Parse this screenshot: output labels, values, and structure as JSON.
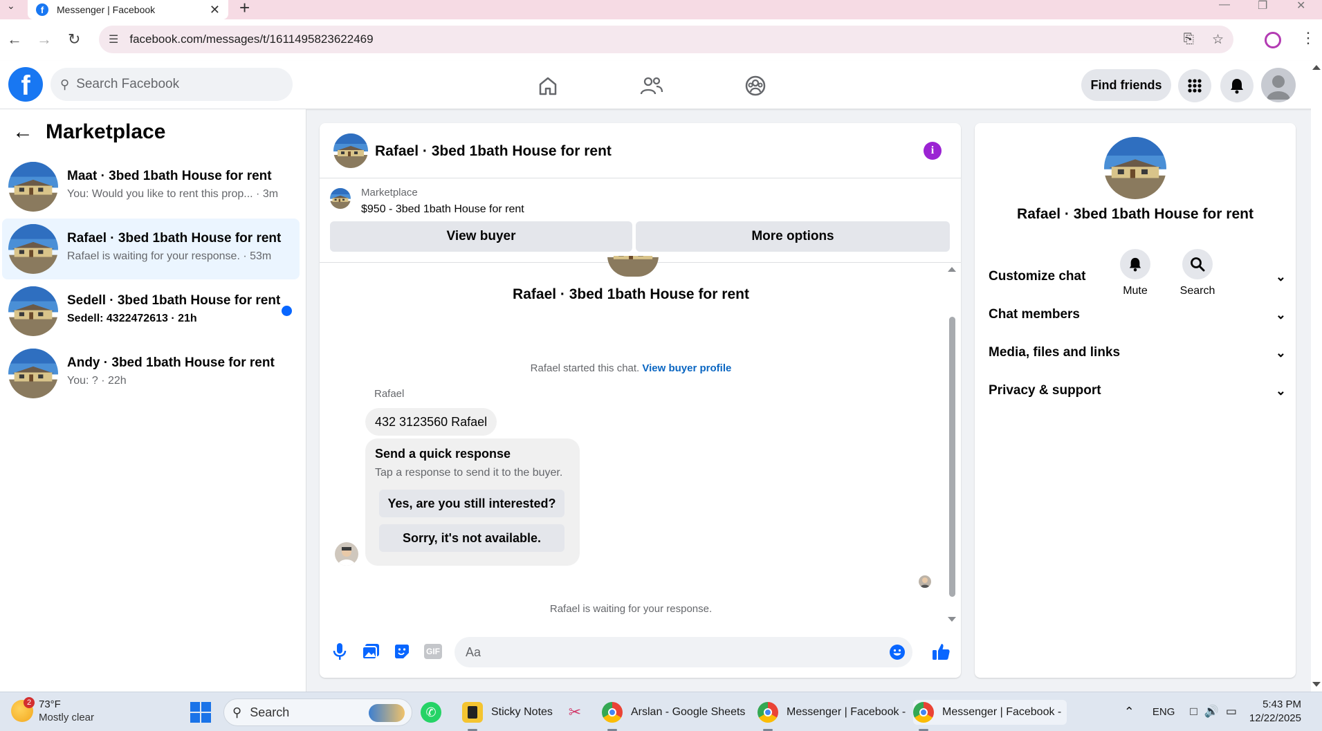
{
  "browser": {
    "tab_title": "Messenger | Facebook",
    "url": "facebook.com/messages/t/1611495823622469"
  },
  "header": {
    "search_placeholder": "Search Facebook",
    "find_friends_label": "Find friends"
  },
  "sidebar": {
    "title": "Marketplace",
    "conversations": [
      {
        "name": "Maat · 3bed 1bath House for rent",
        "preview": "You: Would you like to rent this prop... · 3m",
        "unread": false,
        "active": false
      },
      {
        "name": "Rafael · 3bed 1bath House for rent",
        "preview": "Rafael is waiting for your response. · 53m",
        "unread": false,
        "active": true
      },
      {
        "name": "Sedell · 3bed 1bath House for rent",
        "preview": "Sedell: 4322472613 · 21h",
        "unread": true,
        "active": false
      },
      {
        "name": "Andy · 3bed 1bath House for rent",
        "preview": "You: ? · 22h",
        "unread": false,
        "active": false
      }
    ]
  },
  "chat": {
    "title": "Rafael · 3bed 1bath House for rent",
    "marketplace_label": "Marketplace",
    "listing": "$950 - 3bed 1bath House for rent",
    "view_buyer_label": "View buyer",
    "more_options_label": "More options",
    "conversation_name": "Rafael · 3bed 1bath House for rent",
    "started_text": "Rafael started this chat.",
    "view_buyer_profile_label": "View buyer profile",
    "sender_name": "Rafael",
    "message_text": "432 3123560 Rafael",
    "quick_title": "Send a quick response",
    "quick_subtitle": "Tap a response to send it to the buyer.",
    "quick_replies": [
      "Yes, are you still interested?",
      "Sorry, it's not available."
    ],
    "waiting_text": "Rafael is waiting for your response.",
    "composer_placeholder": "Aa",
    "gif_label": "GIF"
  },
  "info_panel": {
    "name": "Rafael · 3bed 1bath House for rent",
    "mute_label": "Mute",
    "search_label": "Search",
    "sections": [
      "Customize chat",
      "Chat members",
      "Media, files and links",
      "Privacy & support"
    ]
  },
  "taskbar": {
    "weather_temp": "73°F",
    "weather_cond": "Mostly clear",
    "weather_badge": "2",
    "search_label": "Search",
    "apps": [
      {
        "label": "Sticky Notes"
      },
      {
        "label": "Arslan - Google Sheets"
      },
      {
        "label": "Messenger | Facebook -"
      },
      {
        "label": "Messenger | Facebook -"
      }
    ],
    "lang": "ENG",
    "time": "5:43 PM",
    "date": "12/22/2025"
  },
  "colors": {
    "fb_blue": "#1877f2",
    "link_blue": "#0a66c2",
    "active_row": "#ebf5ff",
    "unread_dot": "#0866ff",
    "info_purple": "#9b23d3",
    "tab_bar": "#f6dbe4"
  }
}
